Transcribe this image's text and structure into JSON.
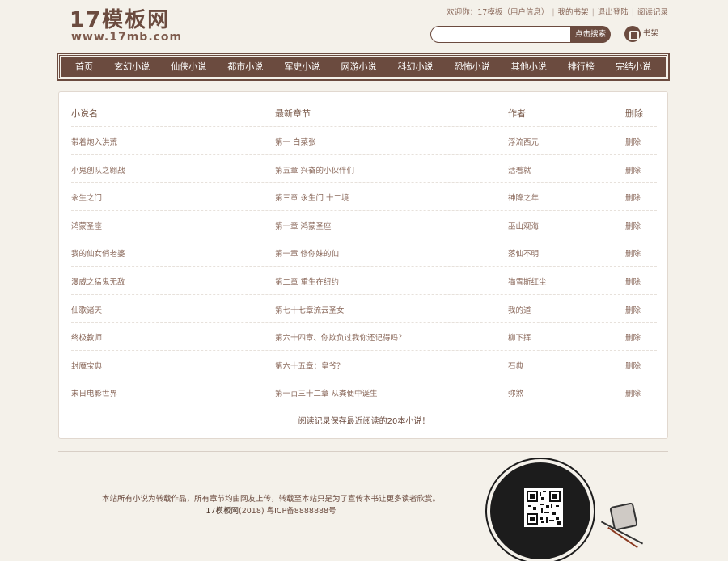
{
  "header": {
    "logo_main": "17模板网",
    "logo_sub": "www.17mb.com",
    "welcome": "欢迎你：17模板（用户信息）",
    "links": [
      "我的书架",
      "退出登陆",
      "阅读记录"
    ],
    "search_placeholder": "",
    "search_button": "点击搜索",
    "bookshelf_label": "书架"
  },
  "nav": {
    "items": [
      "首页",
      "玄幻小说",
      "仙侠小说",
      "都市小说",
      "军史小说",
      "网游小说",
      "科幻小说",
      "恐怖小说",
      "其他小说",
      "排行榜",
      "完结小说"
    ]
  },
  "table": {
    "headers": [
      "小说名",
      "最新章节",
      "作者",
      "删除"
    ],
    "rows": [
      {
        "name": "带着炮入洪荒",
        "chapter": "第一 白菜张",
        "author": "浮流西元",
        "action": "删除"
      },
      {
        "name": "小鬼创队之翱战",
        "chapter": "第五章 兴奋的小伙伴们",
        "author": "活着就",
        "action": "删除"
      },
      {
        "name": "永生之门",
        "chapter": "第三章 永生门 十二境",
        "author": "神降之年",
        "action": "删除"
      },
      {
        "name": "鸿蒙圣座",
        "chapter": "第一章 鸿蒙圣座",
        "author": "巫山观海",
        "action": "删除"
      },
      {
        "name": "我的仙女俏老婆",
        "chapter": "第一章 修你妹的仙",
        "author": "落仙不明",
        "action": "删除"
      },
      {
        "name": "漫威之猛鬼无敌",
        "chapter": "第二章 重生在纽约",
        "author": "猫雪斯红尘",
        "action": "删除"
      },
      {
        "name": "仙歌诸天",
        "chapter": "第七十七章流云圣女",
        "author": "我的道",
        "action": "删除"
      },
      {
        "name": "终极教师",
        "chapter": "第六十四章、你欺负过我你还记得吗？",
        "author": "柳下挥",
        "action": "删除"
      },
      {
        "name": "封魔宝典",
        "chapter": "第六十五章：皇爷？",
        "author": "石典",
        "action": "删除"
      },
      {
        "name": "末日电影世界",
        "chapter": "第一百三十二章 从粪便中诞生",
        "author": "弥煞",
        "action": "删除"
      }
    ],
    "note": "阅读记录保存最近阅读的20本小说！"
  },
  "footer": {
    "line1": "本站所有小说为转载作品，所有章节均由网友上传，转载至本站只是为了宣传本书让更多读者欣赏。",
    "site_name": "17模板网",
    "year": "(2018)",
    "icp": "粤ICP备8888888号"
  }
}
